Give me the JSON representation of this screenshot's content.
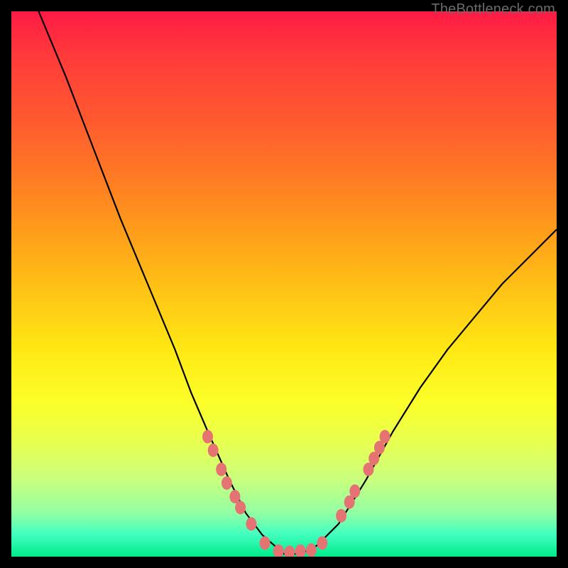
{
  "attribution": "TheBottleneck.com",
  "chart_data": {
    "type": "line",
    "title": "",
    "xlabel": "",
    "ylabel": "",
    "xlim": [
      0,
      100
    ],
    "ylim": [
      0,
      100
    ],
    "grid": false,
    "legend": false,
    "series": [
      {
        "name": "bottleneck-curve",
        "x": [
          5,
          10,
          15,
          20,
          25,
          30,
          33,
          36,
          40,
          43,
          46,
          50,
          53,
          56,
          60,
          65,
          70,
          75,
          80,
          85,
          90,
          95,
          100
        ],
        "y": [
          100,
          88,
          75,
          62,
          50,
          38,
          30,
          23,
          14,
          8,
          4,
          0.5,
          0.5,
          2,
          6,
          14,
          23,
          31,
          38,
          44,
          50,
          55,
          60
        ]
      }
    ],
    "markers": [
      {
        "x": 36.0,
        "y": 22.0
      },
      {
        "x": 37.0,
        "y": 19.5
      },
      {
        "x": 38.5,
        "y": 16.0
      },
      {
        "x": 39.5,
        "y": 13.5
      },
      {
        "x": 41.0,
        "y": 11.0
      },
      {
        "x": 42.0,
        "y": 9.0
      },
      {
        "x": 44.0,
        "y": 6.0
      },
      {
        "x": 46.5,
        "y": 2.5
      },
      {
        "x": 49.0,
        "y": 1.0
      },
      {
        "x": 51.0,
        "y": 0.8
      },
      {
        "x": 53.0,
        "y": 1.0
      },
      {
        "x": 55.0,
        "y": 1.2
      },
      {
        "x": 57.0,
        "y": 2.5
      },
      {
        "x": 60.5,
        "y": 7.5
      },
      {
        "x": 62.0,
        "y": 10.0
      },
      {
        "x": 63.0,
        "y": 12.0
      },
      {
        "x": 65.5,
        "y": 16.0
      },
      {
        "x": 66.5,
        "y": 18.0
      },
      {
        "x": 67.5,
        "y": 20.0
      },
      {
        "x": 68.5,
        "y": 22.0
      }
    ],
    "marker_color": "#e57373",
    "line_color": "#000000"
  }
}
